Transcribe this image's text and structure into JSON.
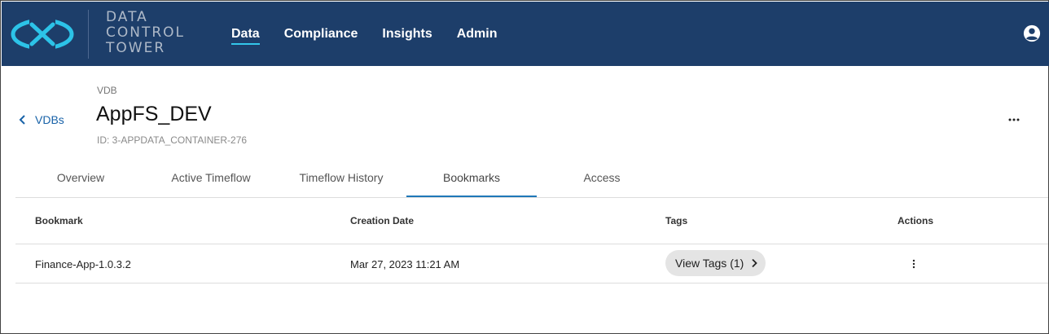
{
  "header": {
    "logo_text": [
      "DATA",
      "CONTROL",
      "TOWER"
    ],
    "nav": [
      {
        "label": "Data",
        "active": true
      },
      {
        "label": "Compliance",
        "active": false
      },
      {
        "label": "Insights",
        "active": false
      },
      {
        "label": "Admin",
        "active": false
      }
    ],
    "user_icon": "account-circle-icon"
  },
  "page": {
    "back_label": "VDBs",
    "eyebrow": "VDB",
    "title": "AppFS_DEV",
    "id_text": "ID: 3-APPDATA_CONTAINER-276",
    "more_icon": "more-horizontal-icon"
  },
  "tabs": [
    {
      "label": "Overview",
      "active": false
    },
    {
      "label": "Active Timeflow",
      "active": false
    },
    {
      "label": "Timeflow History",
      "active": false
    },
    {
      "label": "Bookmarks",
      "active": true
    },
    {
      "label": "Access",
      "active": false
    }
  ],
  "table": {
    "columns": [
      "Bookmark",
      "Creation Date",
      "Tags",
      "Actions"
    ],
    "rows": [
      {
        "bookmark": "Finance-App-1.0.3.2",
        "creation_date": "Mar 27, 2023 11:21 AM",
        "tags_label": "View Tags (1)",
        "actions_icon": "more-vertical-icon"
      }
    ]
  },
  "colors": {
    "header_bg": "#1d3e6a",
    "nav_underline": "#33c6ea",
    "link": "#1862a8",
    "tab_active_underline": "#1f78b8",
    "logo_cyan": "#2cc3e8"
  }
}
